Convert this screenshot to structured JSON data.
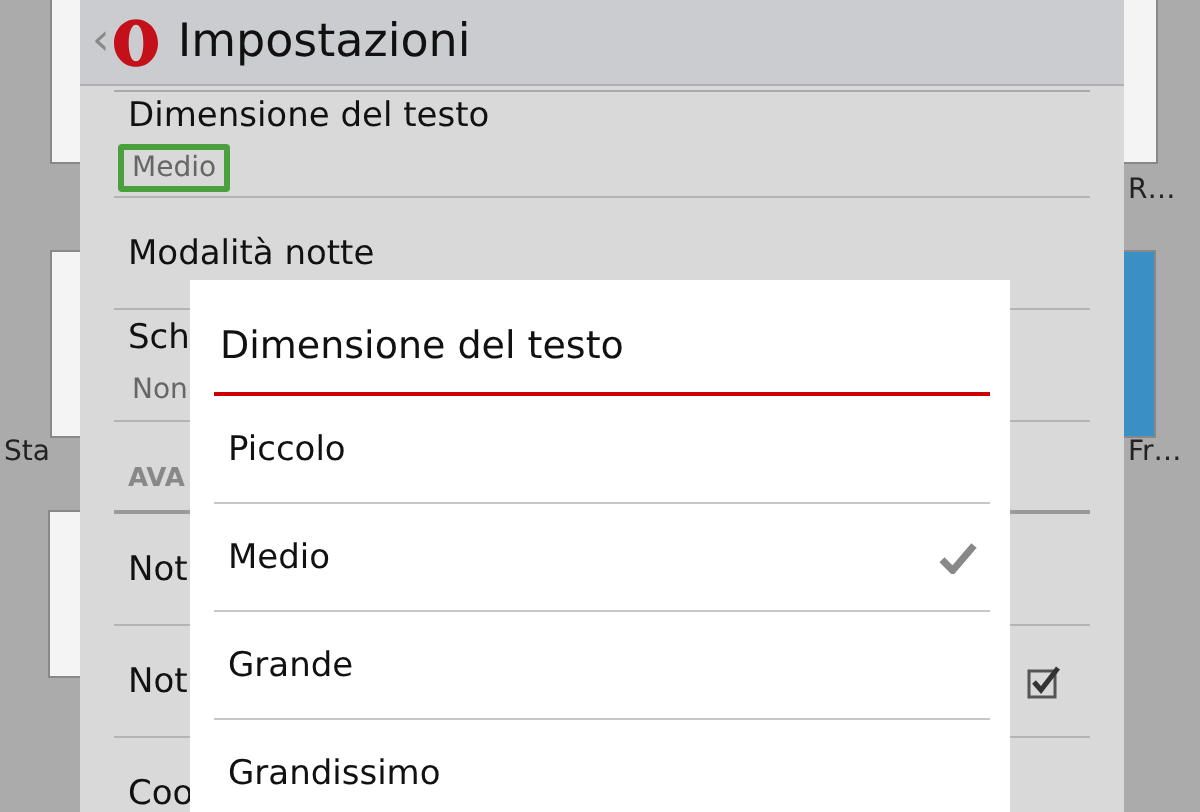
{
  "background": {
    "left_label": "Sta",
    "right_labels": [
      "R…",
      "Fr…"
    ]
  },
  "header": {
    "back": "‹",
    "title": "Impostazioni"
  },
  "settings": [
    {
      "kind": "item",
      "title": "Dimensione del testo",
      "value": "Medio",
      "value_highlighted": true
    },
    {
      "kind": "item",
      "title": "Modalità notte"
    },
    {
      "kind": "item",
      "title": "Sch",
      "value": "Non"
    },
    {
      "kind": "section",
      "title": "AVA"
    },
    {
      "kind": "item",
      "title": "Not"
    },
    {
      "kind": "check",
      "title": "Not",
      "checked": true
    },
    {
      "kind": "item",
      "title": "Coo"
    }
  ],
  "dialog": {
    "title": "Dimensione del testo",
    "options": [
      {
        "label": "Piccolo",
        "selected": false
      },
      {
        "label": "Medio",
        "selected": true
      },
      {
        "label": "Grande",
        "selected": false
      },
      {
        "label": "Grandissimo",
        "selected": false
      }
    ]
  }
}
